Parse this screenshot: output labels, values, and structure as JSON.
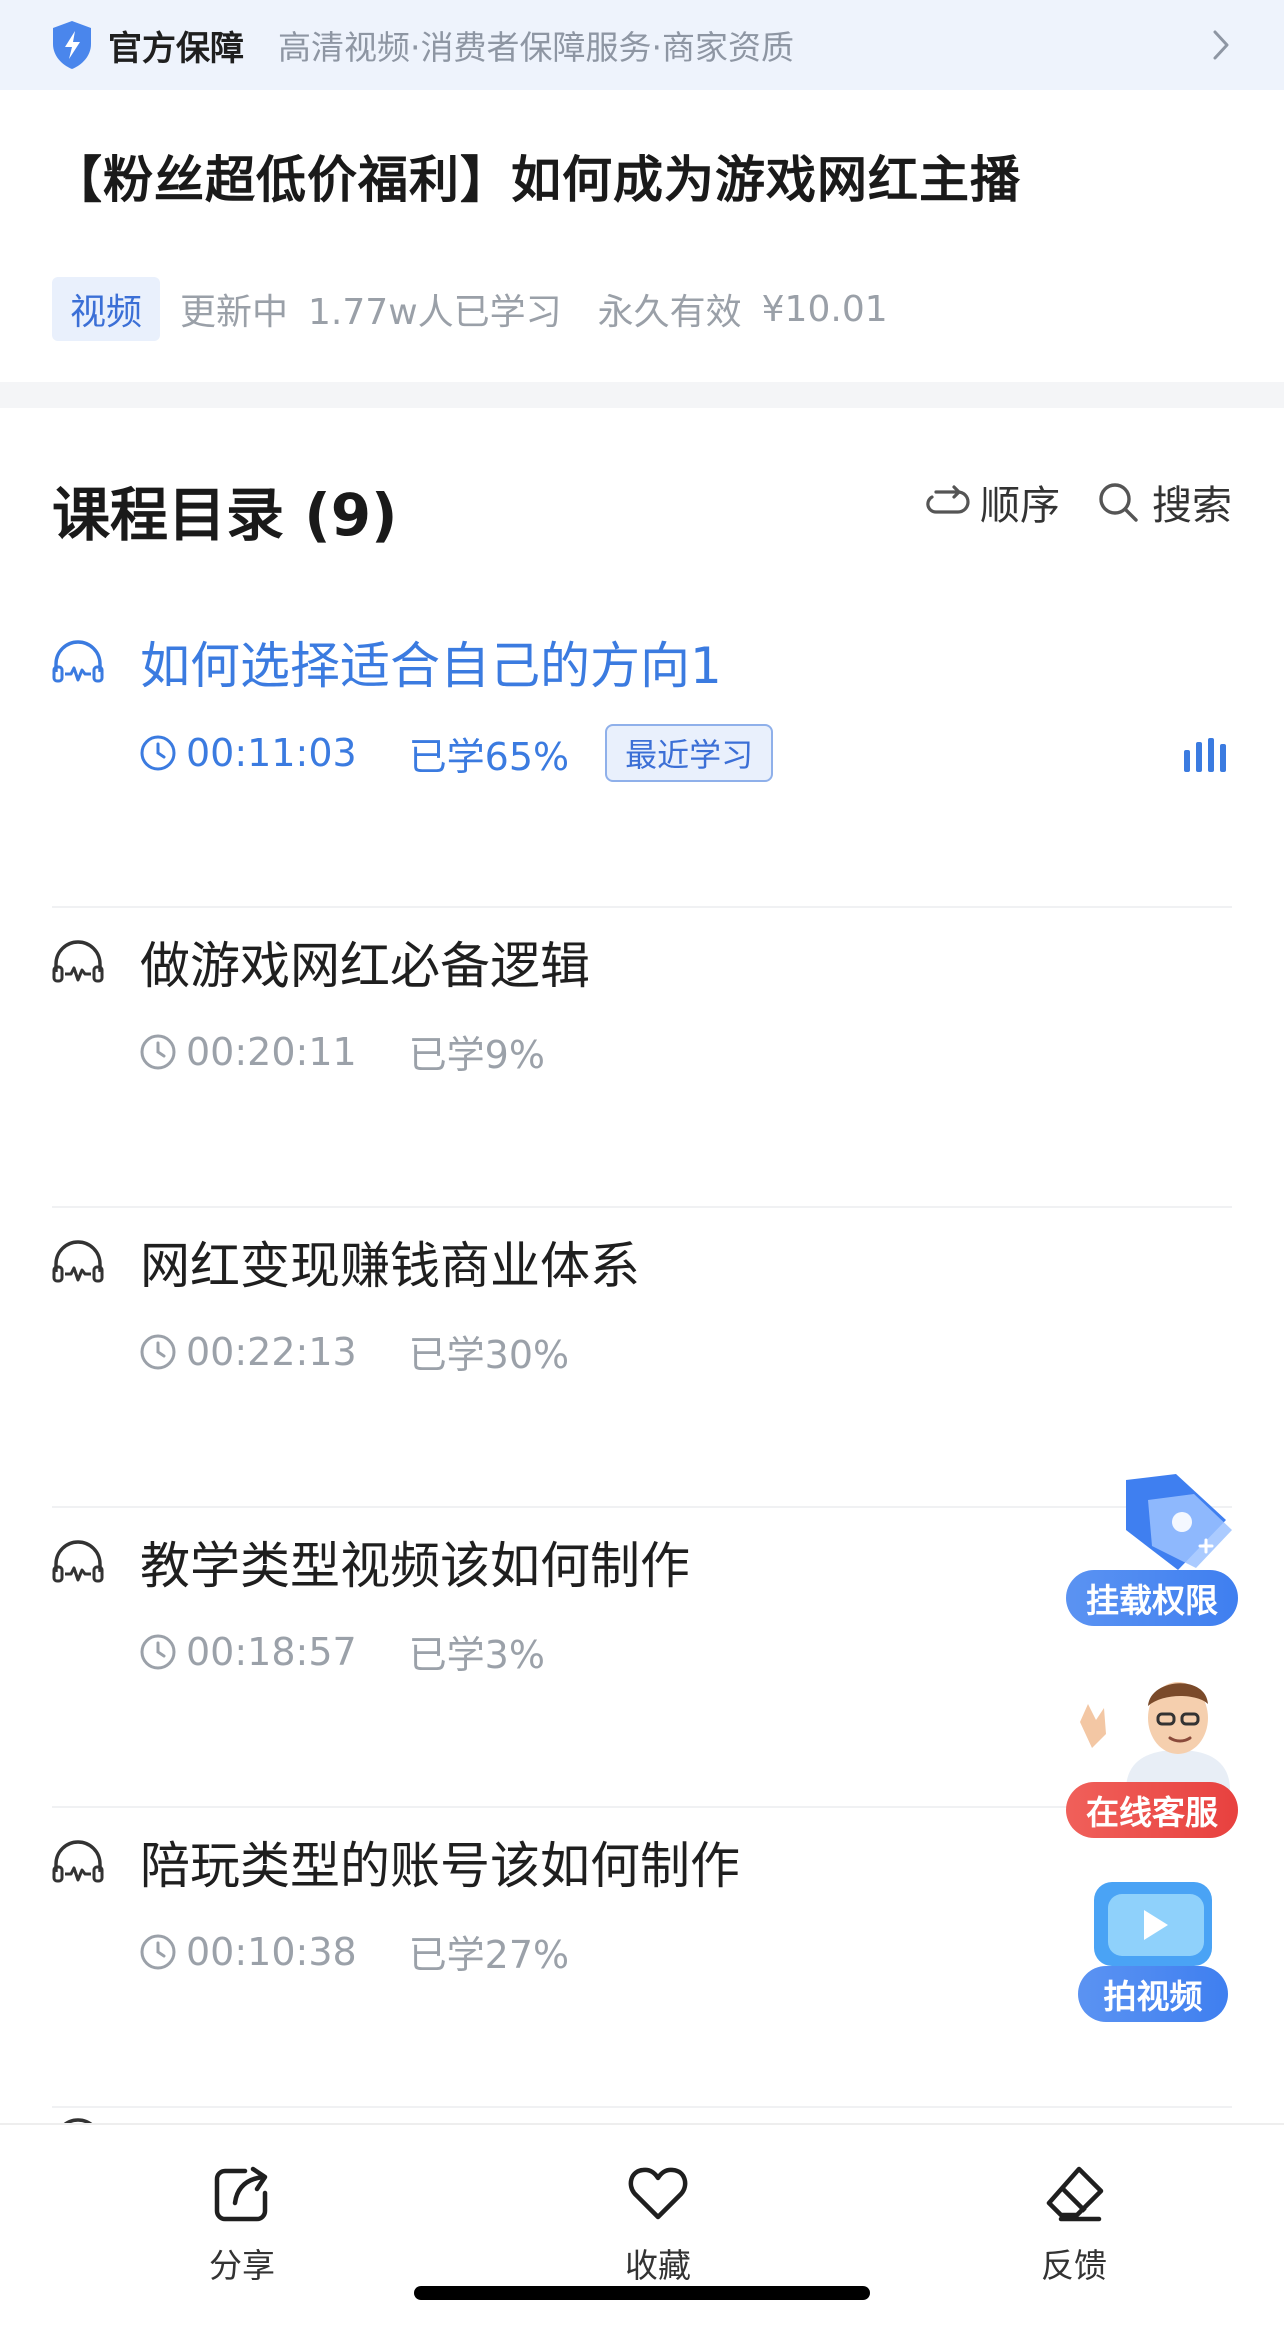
{
  "guarantee": {
    "title": "官方保障",
    "subtitle": "高清视频·消费者保障服务·商家资质"
  },
  "course": {
    "title": "【粉丝超低价福利】如何成为游戏网红主播",
    "tag": "视频",
    "status": "更新中",
    "learners": "1.77w人已学习",
    "validity": "永久有效",
    "price": "¥10.01"
  },
  "catalog": {
    "title": "课程目录 (9)",
    "order_label": "顺序",
    "search_label": "搜索"
  },
  "lessons": [
    {
      "title": "如何选择适合自己的方向1",
      "duration": "00:11:03",
      "progress": "已学65%",
      "badge": "最近学习",
      "active": true
    },
    {
      "title": "做游戏网红必备逻辑",
      "duration": "00:20:11",
      "progress": "已学9%"
    },
    {
      "title": "网红变现赚钱商业体系",
      "duration": "00:22:13",
      "progress": "已学30%"
    },
    {
      "title": "教学类型视频该如何制作",
      "duration": "00:18:57",
      "progress": "已学3%"
    },
    {
      "title": "陪玩类型的账号该如何制作",
      "duration": "00:10:38",
      "progress": "已学27%"
    }
  ],
  "floating": {
    "mount_label": "挂载权限",
    "service_label": "在线客服",
    "shoot_label": "拍视频"
  },
  "bottom": {
    "share_label": "分享",
    "favorite_label": "收藏",
    "feedback_label": "反馈"
  },
  "colors": {
    "accent": "#3b7be0",
    "muted": "#9ba1a9",
    "banner_bg": "#eef3fc",
    "service_red": "#e8413f"
  }
}
